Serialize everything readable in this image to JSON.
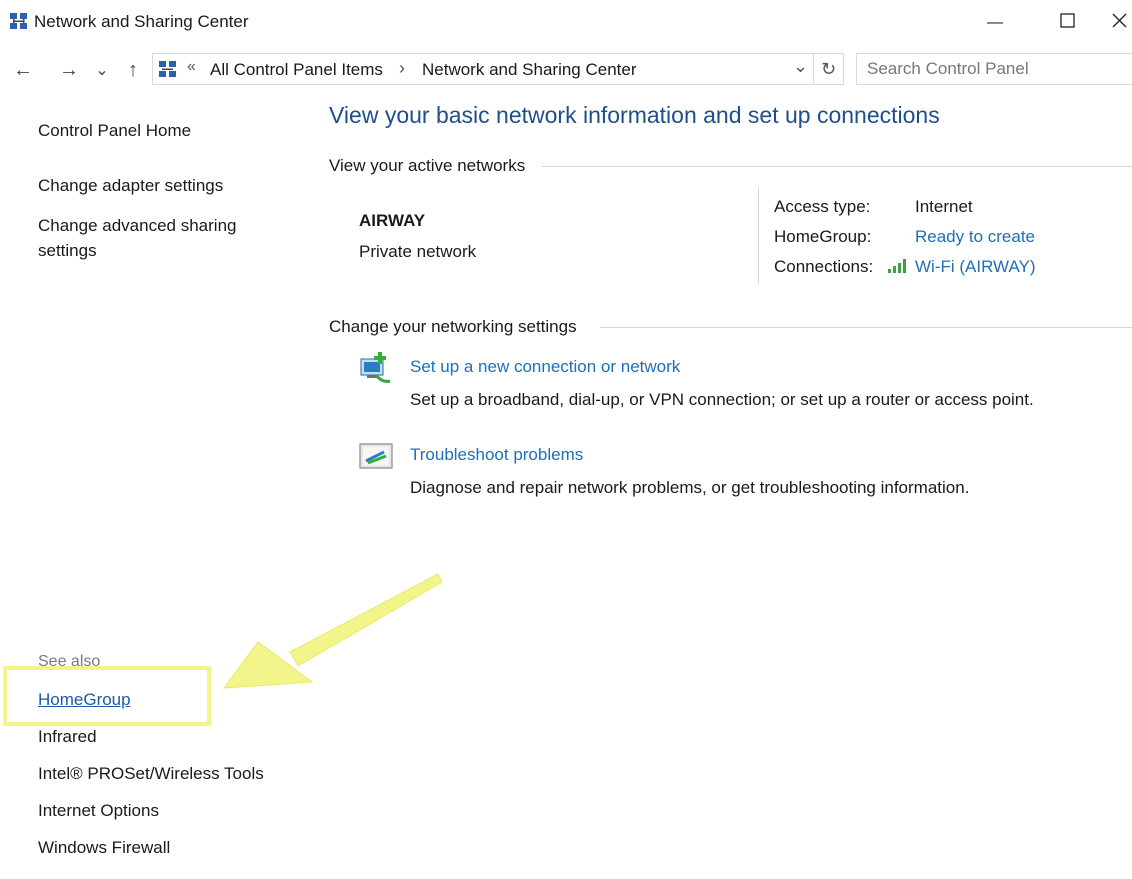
{
  "window": {
    "title": "Network and Sharing Center",
    "minimize_glyph": "—",
    "maximize_glyph": "☐"
  },
  "nav": {
    "back_glyph": "←",
    "forward_glyph": "→",
    "recent_glyph": "⌄",
    "up_glyph": "↑"
  },
  "address": {
    "overflow_glyph": "«",
    "separator_glyph": "›",
    "crumbs": [
      "All Control Panel Items",
      "Network and Sharing Center"
    ],
    "dropdown_glyph": "⌄",
    "refresh_glyph": "↻"
  },
  "search": {
    "placeholder": "Search Control Panel"
  },
  "sidebar": {
    "home": "Control Panel Home",
    "tasks": [
      "Change adapter settings",
      "Change advanced sharing",
      "settings"
    ],
    "see_also_title": "See also",
    "see_also": [
      "HomeGroup",
      "Infrared",
      "Intel® PROSet/Wireless Tools",
      "Internet Options",
      "Windows Firewall"
    ]
  },
  "main": {
    "heading": "View your basic network information and set up connections",
    "active_networks_label": "View your active networks",
    "network": {
      "name": "AIRWAY",
      "type": "Private network",
      "access_type_label": "Access type:",
      "access_type_value": "Internet",
      "homegroup_label": "HomeGroup:",
      "homegroup_value": "Ready to create",
      "connections_label": "Connections:",
      "connections_value": "Wi-Fi (AIRWAY)"
    },
    "change_settings_label": "Change your networking settings",
    "tasks": [
      {
        "title": "Set up a new connection or network",
        "desc": "Set up a broadband, dial-up, or VPN connection; or set up a router or access point."
      },
      {
        "title": "Troubleshoot problems",
        "desc": "Diagnose and repair network problems, or get troubleshooting information."
      }
    ]
  },
  "colors": {
    "link": "#1e6fb8",
    "heading": "#1f4e8c",
    "highlight": "#f3f58a",
    "signal": "#3aa53a"
  }
}
